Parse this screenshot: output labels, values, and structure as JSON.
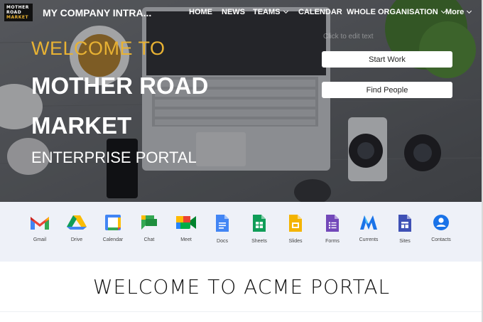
{
  "header": {
    "logo_lines": [
      "MOTHER",
      "ROAD",
      "MARKET"
    ],
    "site_title": "MY COMPANY INTRA...",
    "nav": [
      {
        "label": "HOME"
      },
      {
        "label": "NEWS"
      },
      {
        "label": "TEAMS"
      },
      {
        "label": "CALENDAR"
      },
      {
        "label": "WHOLE ORGANISATION"
      },
      {
        "label": "More"
      }
    ]
  },
  "hero": {
    "welcome": "WELCOME TO",
    "title_line1": "MOTHER ROAD",
    "title_line2": "MARKET",
    "subtitle": "ENTERPRISE PORTAL",
    "edit_hint": "Click to edit text",
    "buttons": {
      "start_work": "Start Work",
      "find_people": "Find People"
    }
  },
  "apps": [
    {
      "label": "Gmail",
      "icon": "gmail-icon"
    },
    {
      "label": "Drive",
      "icon": "drive-icon"
    },
    {
      "label": "Calendar",
      "icon": "calendar-icon"
    },
    {
      "label": "Chat",
      "icon": "chat-icon"
    },
    {
      "label": "Meet",
      "icon": "meet-icon"
    },
    {
      "label": "Docs",
      "icon": "docs-icon"
    },
    {
      "label": "Sheets",
      "icon": "sheets-icon"
    },
    {
      "label": "Slides",
      "icon": "slides-icon"
    },
    {
      "label": "Forms",
      "icon": "forms-icon"
    },
    {
      "label": "Currents",
      "icon": "currents-icon"
    },
    {
      "label": "Sites",
      "icon": "sites-icon"
    },
    {
      "label": "Contacts",
      "icon": "contacts-icon"
    }
  ],
  "section": {
    "title": "WELCOME TO ACME PORTAL"
  },
  "colors": {
    "accent": "#e8b233",
    "apps_bg": "#eef1f8"
  }
}
